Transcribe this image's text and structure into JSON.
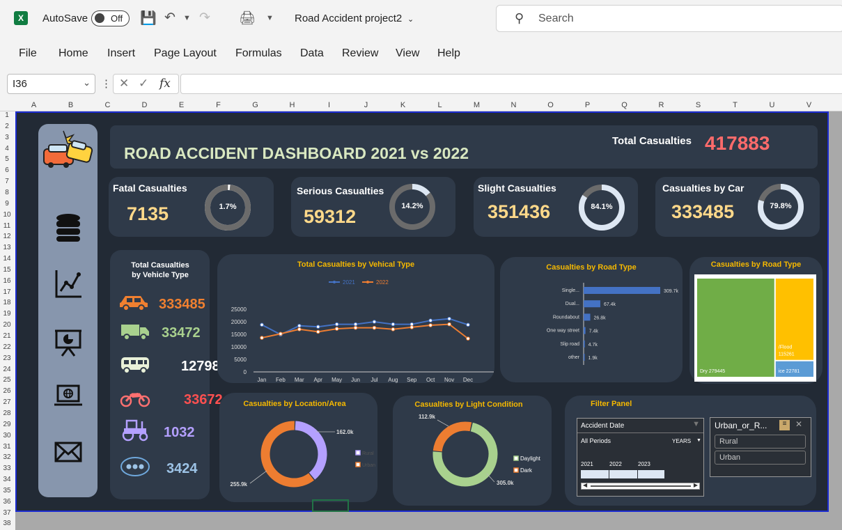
{
  "titlebar": {
    "app_logo": "X",
    "autosave_label": "AutoSave",
    "autosave_state": "Off",
    "filename": "Road Accident project2",
    "search_placeholder": "Search"
  },
  "menu": [
    "File",
    "Home",
    "Insert",
    "Page Layout",
    "Formulas",
    "Data",
    "Review",
    "View",
    "Help"
  ],
  "formula_bar": {
    "name_box": "I36",
    "fx_label": "fx",
    "formula": ""
  },
  "columns": [
    "A",
    "B",
    "C",
    "D",
    "E",
    "F",
    "G",
    "H",
    "I",
    "J",
    "K",
    "L",
    "M",
    "N",
    "O",
    "P",
    "Q",
    "R",
    "S",
    "T",
    "U",
    "V"
  ],
  "rows": [
    "1",
    "2",
    "3",
    "4",
    "5",
    "6",
    "7",
    "8",
    "9",
    "10",
    "11",
    "12",
    "13",
    "14",
    "15",
    "16",
    "17",
    "18",
    "19",
    "20",
    "21",
    "22",
    "23",
    "24",
    "25",
    "26",
    "27",
    "28",
    "29",
    "30",
    "31",
    "32",
    "33",
    "34",
    "35",
    "36",
    "37",
    "38"
  ],
  "dashboard": {
    "title": "ROAD ACCIDENT DASHBOARD  2021 vs 2022",
    "total_casualties_label": "Total Casualties",
    "total_casualties_value": "417883",
    "kpis": [
      {
        "label": "Fatal Casualties",
        "value": "7135",
        "pct": "1.7%",
        "fraction": 0.017
      },
      {
        "label": "Serious Casualties",
        "value": "59312",
        "pct": "14.2%",
        "fraction": 0.142
      },
      {
        "label": "Slight Casualties",
        "value": "351436",
        "pct": "84.1%",
        "fraction": 0.841
      },
      {
        "label": "Casualties by Car",
        "value": "333485",
        "pct": "79.8%",
        "fraction": 0.798
      }
    ],
    "vehicle_panel": {
      "title_line1": "Total Casualties",
      "title_line2": "by  Vehicle Type",
      "items": [
        {
          "icon": "car-icon",
          "value": "333485",
          "color": "#f08030"
        },
        {
          "icon": "truck-icon",
          "value": "33472",
          "color": "#a9d18e"
        },
        {
          "icon": "bus-icon",
          "value": "12798",
          "color": "#ffffff"
        },
        {
          "icon": "motorcycle-icon",
          "value": "33672",
          "color": "#ff5050"
        },
        {
          "icon": "tractor-icon",
          "value": "1032",
          "color": "#b4a0ff"
        },
        {
          "icon": "other-vehicle-icon",
          "value": "3424",
          "color": "#9dc3e6"
        }
      ]
    },
    "filter_panel": {
      "title": "Filter Panel",
      "date_slicer_title": "Accident Date",
      "date_slicer_period": "All Periods",
      "date_slicer_level": "YEARS",
      "years": [
        "2021",
        "2022",
        "2023"
      ],
      "area_slicer_title": "Urban_or_R...",
      "area_options": [
        "Rural",
        "Urban"
      ]
    }
  },
  "chart_data": [
    {
      "type": "line",
      "title": "Total Casualties by Vehical Type",
      "categories": [
        "Jan",
        "Feb",
        "Mar",
        "Apr",
        "May",
        "Jun",
        "Jul",
        "Aug",
        "Sep",
        "Oct",
        "Nov",
        "Dec"
      ],
      "series": [
        {
          "name": "2021",
          "color": "#4472c4",
          "values": [
            18800,
            14900,
            18400,
            18000,
            19000,
            19000,
            20000,
            19000,
            19000,
            20500,
            21200,
            18800
          ]
        },
        {
          "name": "2022",
          "color": "#ed7d31",
          "values": [
            13600,
            15200,
            17000,
            16000,
            17200,
            17600,
            17600,
            17000,
            17800,
            18600,
            19000,
            13300
          ]
        }
      ],
      "ylim": [
        0,
        25000
      ],
      "yticks": [
        "25000",
        "20000",
        "15000",
        "10000",
        "5000",
        "0"
      ]
    },
    {
      "type": "bar",
      "title": "Casualties  by Road Type",
      "categories": [
        "Single...",
        "Dual...",
        "Roundabout",
        "One way street",
        "Slip road",
        "other"
      ],
      "values": [
        309.7,
        67.4,
        26.8,
        7.4,
        4.7,
        1.9
      ],
      "labels": [
        "309.7k",
        "67.4k",
        "26.8k",
        "7.4k",
        "4.7k",
        "1.9k"
      ],
      "color": "#4472c4"
    },
    {
      "type": "heatmap",
      "title": "Casualties by Road Type",
      "cells": [
        {
          "label": "Dry 279445",
          "value": 279445,
          "color": "#70ad47"
        },
        {
          "label": "/Flood 115261",
          "value": 115261,
          "color": "#ffc000"
        },
        {
          "label": "ice 22781",
          "value": 22781,
          "color": "#5b9bd5"
        }
      ]
    },
    {
      "type": "pie",
      "title": "Casualties by Location/Area",
      "categories": [
        "Rural",
        "Urban"
      ],
      "values": [
        162.0,
        255.9
      ],
      "labels": [
        "162.0k",
        "255.9k"
      ],
      "colors": [
        "#b4a0ff",
        "#ed7d31"
      ]
    },
    {
      "type": "pie",
      "title": "Casualties by Light Condition",
      "categories": [
        "Daylight",
        "Dark"
      ],
      "values": [
        305.0,
        112.9
      ],
      "labels": [
        "305.0k",
        "112.9k"
      ],
      "colors": [
        "#a9d18e",
        "#ed7d31"
      ]
    }
  ]
}
